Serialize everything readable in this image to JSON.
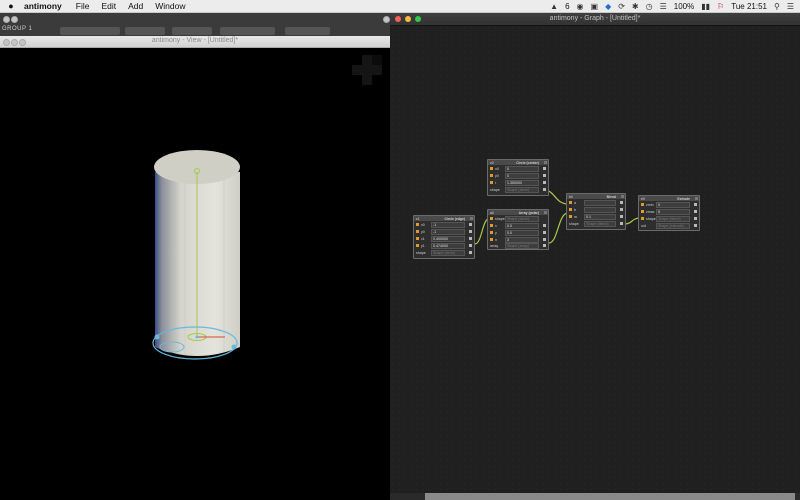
{
  "menubar": {
    "app_name": "antimony",
    "menus": [
      "File",
      "Edit",
      "Add",
      "Window"
    ],
    "status": {
      "adobe_badge": "6",
      "battery": "100%",
      "time": "Tue 21:51"
    }
  },
  "desktop": {
    "group_label": "GROUP 1"
  },
  "view_window": {
    "title": "antimony - View - [Untitled]*"
  },
  "graph_window": {
    "title": "antimony - Graph - [Untitled]*"
  },
  "nodes": {
    "circle_center": {
      "id": "c0",
      "title": "Circle (center)",
      "rows": [
        {
          "label": "x0",
          "value": "0"
        },
        {
          "label": "y0",
          "value": "0"
        },
        {
          "label": "r",
          "value": "1.350000"
        },
        {
          "label": "shape",
          "value": "Shape (circle)"
        }
      ]
    },
    "circle_edge": {
      "id": "c1",
      "title": "Circle (edge)",
      "rows": [
        {
          "label": "x0",
          "value": "-1"
        },
        {
          "label": "y0",
          "value": "-1"
        },
        {
          "label": "x1",
          "value": "0.400000"
        },
        {
          "label": "y1",
          "value": "0.474000"
        },
        {
          "label": "shape",
          "value": "Shape (circle)"
        }
      ]
    },
    "array_polar": {
      "id": "a0",
      "title": "Array (polar)",
      "rows": [
        {
          "label": "shape",
          "value": "Shape (circle)"
        },
        {
          "label": "x",
          "value": "0.0"
        },
        {
          "label": "y",
          "value": "0.0"
        },
        {
          "label": "n",
          "value": "3"
        },
        {
          "label": "array",
          "value": "Shape (array)"
        }
      ]
    },
    "blend": {
      "id": "b0",
      "title": "Blend",
      "rows": [
        {
          "label": "a",
          "value": ""
        },
        {
          "label": "b",
          "value": ""
        },
        {
          "label": "m",
          "value": "0.1"
        },
        {
          "label": "shape",
          "value": "Shape (blend)"
        }
      ]
    },
    "extrude": {
      "id": "e0",
      "title": "Extrude",
      "rows": [
        {
          "label": "zmin",
          "value": "0"
        },
        {
          "label": "zmax",
          "value": "5"
        },
        {
          "label": "shape",
          "value": "Shape (blend)"
        },
        {
          "label": "out",
          "value": "Shape (extrude)"
        }
      ]
    }
  },
  "colors": {
    "wire": "#a6c94a",
    "pin": "#e09a2a",
    "selection": "#69b8e0",
    "cylinder": "#e4e4dc",
    "close_button": "#fc605c",
    "min_button": "#fdbc40",
    "max_button": "#34c84a"
  }
}
